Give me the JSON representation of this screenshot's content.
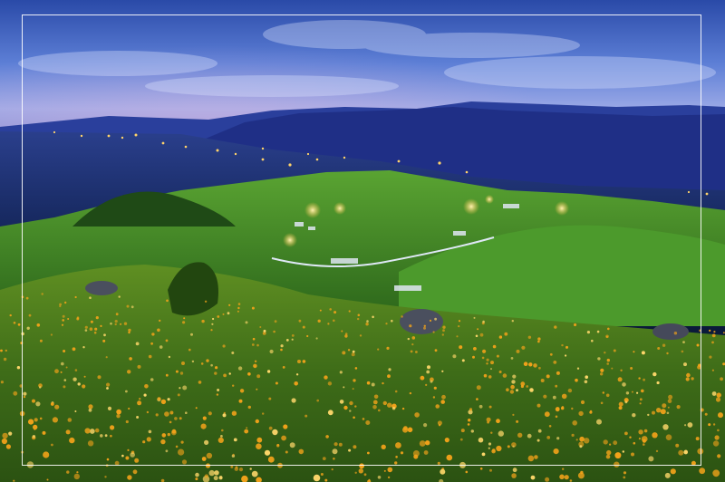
{
  "photo": {
    "subject": "",
    "colors": {
      "sky_top": "#2d4fae",
      "sky_mid": "#6f86d8",
      "sky_glow": "#c8a6d8",
      "mountains": "#233a8f",
      "valley": "#1b2f6e",
      "hills": "#3f8a2a",
      "hills_light": "#6fb43a",
      "meadow": "#4a7a1e",
      "flowers": "#f2a21a",
      "lights": "#ffd36a",
      "frame": "#ffffff"
    }
  }
}
